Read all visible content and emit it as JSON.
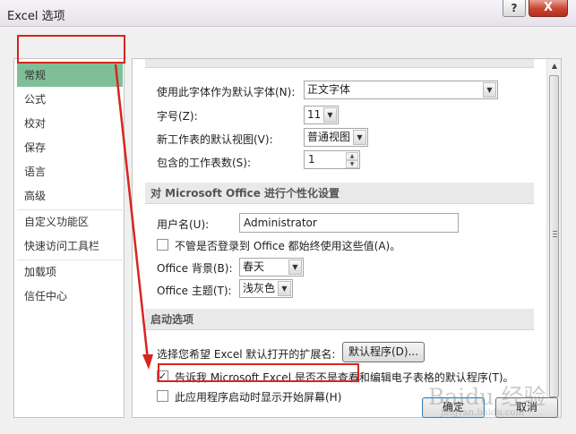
{
  "window": {
    "title": "Excel 选项",
    "help_label": "?",
    "close_label": "X"
  },
  "nav": {
    "items": [
      {
        "label": "常规"
      },
      {
        "label": "公式"
      },
      {
        "label": "校对"
      },
      {
        "label": "保存"
      },
      {
        "label": "语言"
      },
      {
        "label": "高级"
      },
      {
        "label": "自定义功能区"
      },
      {
        "label": "快速访问工具栏"
      },
      {
        "label": "加载项"
      },
      {
        "label": "信任中心"
      }
    ],
    "selected": "常规"
  },
  "general": {
    "font_label": "使用此字体作为默认字体(N):",
    "font_value": "正文字体",
    "size_label": "字号(Z):",
    "size_value": "11",
    "view_label": "新工作表的默认视图(V):",
    "view_value": "普通视图",
    "sheets_label": "包含的工作表数(S):",
    "sheets_value": "1"
  },
  "personalize": {
    "header": "对 Microsoft Office 进行个性化设置",
    "username_label": "用户名(U):",
    "username_value": "Administrator",
    "always_use_label": "不管是否登录到 Office 都始终使用这些值(A)。",
    "always_use_checked": false,
    "background_label": "Office 背景(B):",
    "background_value": "春天",
    "theme_label": "Office 主题(T):",
    "theme_value": "浅灰色"
  },
  "startup": {
    "header": "启动选项",
    "extensions_label": "选择您希望 Excel 默认打开的扩展名:",
    "default_programs_button": "默认程序(D)...",
    "tell_me_label": "告诉我 Microsoft Excel 是否不是查看和编辑电子表格的默认程序(T)。",
    "tell_me_checked": true,
    "show_start_label": "此应用程序启动时显示开始屏幕(H)",
    "show_start_checked": false
  },
  "footer": {
    "ok_label": "确定",
    "cancel_label": "取消"
  },
  "watermark": {
    "text": "Baidu 经验",
    "sub": "jingyan.baidu.com"
  },
  "colors": {
    "selected_nav": "#7fbf97",
    "annotation_red": "#d7261e",
    "close_button": "#c9432f"
  }
}
